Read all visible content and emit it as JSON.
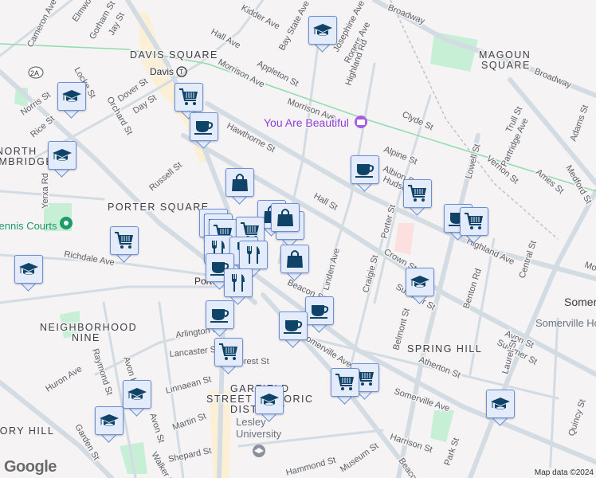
{
  "areas": [
    "DAVIS SQUARE",
    "MAGOUN",
    "SQUARE",
    "PORTER SQUARE",
    "NORTH",
    "CAMBRIDGE",
    "NEIGHBORHOOD",
    "NINE",
    "SPRING HILL",
    "GARFIELD",
    "STREET HISTORIC",
    "DISTRICT",
    "OBSERVATORY HILL",
    "Somerville"
  ],
  "streets": [
    "Cameron Ave",
    "Elmwood St",
    "Gorham St",
    "Jay St",
    "Kidder Ave",
    "Hall Ave",
    "Bay State Ave",
    "Josephine Ave",
    "Rogers Ave",
    "Highland Rd",
    "Broadway",
    "Broadway",
    "Morrison Ave",
    "Appleton St",
    "Morrison Ave",
    "Clyde St",
    "Alpine St",
    "Albion St",
    "Hudson St",
    "Hall St",
    "Lowell St",
    "Vernon St",
    "Trull St",
    "Partridge Ave",
    "Adams St",
    "Ames St",
    "Medford St",
    "Central St",
    "Highland Ave",
    "Summer St",
    "Summer St",
    "Hawthorne St",
    "Dover St",
    "Day St",
    "Orchard St",
    "Locke St",
    "Norris St",
    "Rice St",
    "Yerxa Rd",
    "Russell St",
    "Richdale Ave",
    "Linden Ave",
    "Craigie St",
    "Porter St",
    "Crown St",
    "Belmont St",
    "Benton Rd",
    "Avon St",
    "Atherton St",
    "Somerville Ave",
    "Somerville Ave",
    "Laurel St",
    "Quincy St",
    "Park St",
    "Harrison St",
    "Beacon St",
    "Museum St",
    "Hammond St",
    "Arlington St",
    "Lancaster St",
    "Linnaean St",
    "Forest St",
    "Raymond St",
    "Avon St",
    "Avon Hill",
    "Huron Ave",
    "Martin St",
    "Shepard St",
    "Walker St",
    "Garden St",
    "Somerville Hospital",
    "Montrose St"
  ],
  "transit": {
    "davis": "Davis",
    "porter": "Porter"
  },
  "poi": {
    "name": "You Are Beautiful",
    "tennis": "Tennis Courts",
    "university": "Lesley\nUniversity",
    "university_line1": "Lesley",
    "university_line2": "University"
  },
  "shield": "2A",
  "markers": [
    "school",
    "school",
    "cart",
    "coffee",
    "school",
    "bag",
    "coffee",
    "cart",
    "coffee",
    "cart",
    "bag",
    "school",
    "cart",
    "cart",
    "cart",
    "cart",
    "bag",
    "fork",
    "fork",
    "fork",
    "coffee",
    "fork",
    "bag",
    "cart",
    "school",
    "coffee",
    "coffee",
    "coffee",
    "school",
    "cart",
    "cart",
    "cart",
    "school",
    "school",
    "school",
    "school"
  ],
  "attribution": {
    "logo": "Google",
    "credit": "Map data ©2024"
  },
  "colors": {
    "marker_fill": "#e4ecfb",
    "marker_border": "#6a8fd6",
    "icon": "#0f4368",
    "road": "#d3dbe3",
    "park": "#c7efd6",
    "commercial": "#fbf0d6"
  }
}
